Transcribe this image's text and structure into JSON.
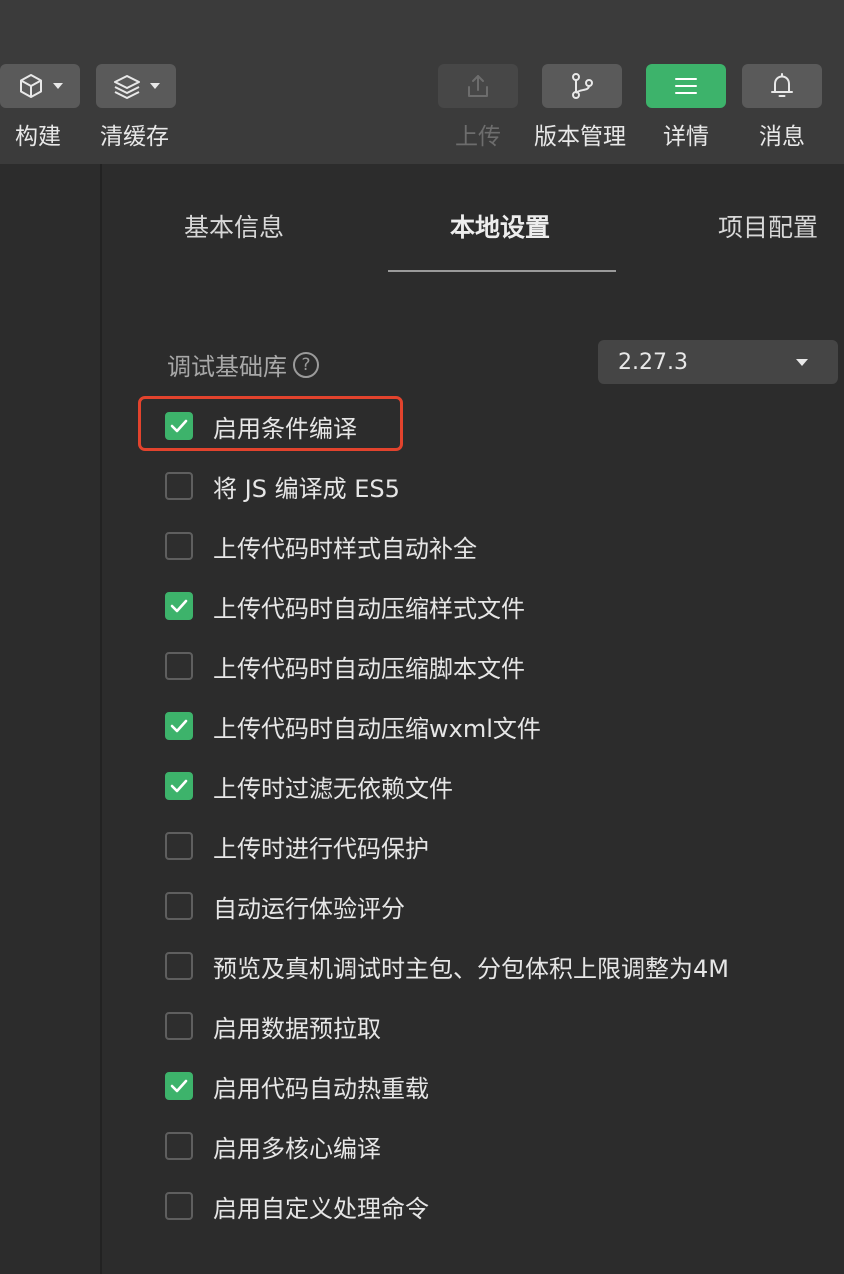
{
  "toolbar": {
    "build": {
      "label": "构建",
      "icon": "cube-icon"
    },
    "clear_cache": {
      "label": "清缓存",
      "icon": "layers-icon"
    },
    "upload": {
      "label": "上传",
      "icon": "upload-icon",
      "disabled": true
    },
    "version_control": {
      "label": "版本管理",
      "icon": "branch-icon"
    },
    "details": {
      "label": "详情",
      "icon": "menu-icon",
      "active": true
    },
    "messages": {
      "label": "消息",
      "icon": "bell-icon"
    }
  },
  "tabs": [
    {
      "label": "基本信息",
      "active": false
    },
    {
      "label": "本地设置",
      "active": true
    },
    {
      "label": "项目配置",
      "active": false
    }
  ],
  "debug_lib": {
    "label": "调试基础库",
    "help": "?",
    "value": "2.27.3"
  },
  "options": [
    {
      "label": "启用条件编译",
      "checked": true,
      "highlighted": true
    },
    {
      "label": "将 JS 编译成 ES5",
      "checked": false
    },
    {
      "label": "上传代码时样式自动补全",
      "checked": false
    },
    {
      "label": "上传代码时自动压缩样式文件",
      "checked": true
    },
    {
      "label": "上传代码时自动压缩脚本文件",
      "checked": false
    },
    {
      "label": "上传代码时自动压缩wxml文件",
      "checked": true
    },
    {
      "label": "上传时过滤无依赖文件",
      "checked": true
    },
    {
      "label": "上传时进行代码保护",
      "checked": false
    },
    {
      "label": "自动运行体验评分",
      "checked": false
    },
    {
      "label": "预览及真机调试时主包、分包体积上限调整为4M",
      "checked": false
    },
    {
      "label": "启用数据预拉取",
      "checked": false
    },
    {
      "label": "启用代码自动热重载",
      "checked": true
    },
    {
      "label": "启用多核心编译",
      "checked": false
    },
    {
      "label": "启用自定义处理命令",
      "checked": false
    }
  ],
  "colors": {
    "accent": "#3db36b",
    "highlight": "#e2432d",
    "background": "#2c2c2c",
    "toolbar": "#3b3b3b"
  }
}
